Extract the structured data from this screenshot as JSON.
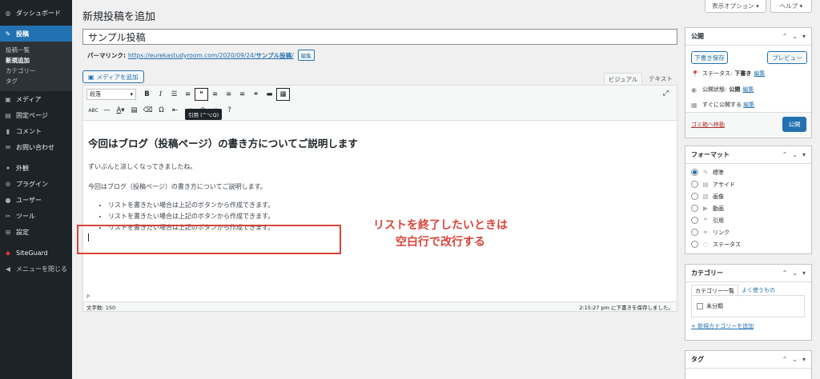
{
  "sidebar": {
    "items": [
      {
        "icon": "dashboard-icon",
        "glyph": "◍",
        "label": "ダッシュボード"
      },
      {
        "icon": "pin-icon",
        "glyph": "✎",
        "label": "投稿"
      },
      {
        "icon": "media-icon",
        "glyph": "▣",
        "label": "メディア"
      },
      {
        "icon": "page-icon",
        "glyph": "▤",
        "label": "固定ページ"
      },
      {
        "icon": "comment-icon",
        "glyph": "▮",
        "label": "コメント"
      },
      {
        "icon": "mail-icon",
        "glyph": "✉",
        "label": "お問い合わせ"
      },
      {
        "icon": "appearance-icon",
        "glyph": "✦",
        "label": "外観"
      },
      {
        "icon": "plugin-icon",
        "glyph": "⚙",
        "label": "プラグイン"
      },
      {
        "icon": "user-icon",
        "glyph": "●",
        "label": "ユーザー"
      },
      {
        "icon": "tool-icon",
        "glyph": "✂",
        "label": "ツール"
      },
      {
        "icon": "settings-icon",
        "glyph": "⊞",
        "label": "設定"
      },
      {
        "icon": "siteguard-icon",
        "glyph": "◆",
        "label": "SiteGuard"
      },
      {
        "icon": "collapse-icon",
        "glyph": "◀",
        "label": "メニューを閉じる"
      }
    ],
    "submenu": [
      "投稿一覧",
      "新規追加",
      "カテゴリー",
      "タグ"
    ]
  },
  "header": {
    "title": "新規投稿を追加",
    "screen_options": "表示オプション ▾",
    "help": "ヘルプ ▾"
  },
  "post": {
    "title": "サンプル投稿",
    "permalink_label": "パーマリンク:",
    "permalink_base": "https://eurekastudyroom.com/2020/09/24/",
    "permalink_slug": "サンプル投稿",
    "permalink_end": "/",
    "edit_label": "編集"
  },
  "editor": {
    "media_button": "メディアを追加",
    "tab_visual": "ビジュアル",
    "tab_text": "テキスト",
    "format_select": "段落",
    "tooltip": "引用 (^⌥Q)",
    "heading": "今回はブログ（投稿ページ）の書き方についてご説明します",
    "para1": "ずいぶんと涼しくなってきましたね。",
    "para2": "今回はブログ（投稿ページ）の書き方についてご説明します。",
    "list": [
      "リストを書きたい場合は上記のボタンから作成できます。",
      "リストを書きたい場合は上記のボタンから作成できます。",
      "リストを書きたい場合は上記のボタンから作成できます。"
    ],
    "path": "P",
    "word_count": "文字数: 150",
    "saved_status": "2:15:27 pm に下書きを保存しました。"
  },
  "annotation": {
    "line1": "リストを終了したいときは",
    "line2": "空白行で改行する",
    "color": "#d9453a"
  },
  "publish": {
    "title": "公開",
    "save_draft": "下書き保存",
    "preview": "プレビュー",
    "status_label": "ステータス:",
    "status_value": "下書き",
    "visibility_label": "公開状態:",
    "visibility_value": "公開",
    "schedule_label": "すぐに公開する",
    "edit": "編集",
    "trash": "ゴミ箱へ移動",
    "publish_button": "公開"
  },
  "format": {
    "title": "フォーマット",
    "options": [
      {
        "label": "標準",
        "icon": "pin-icon",
        "glyph": "✎",
        "selected": true
      },
      {
        "label": "アサイド",
        "icon": "aside-icon",
        "glyph": "▤",
        "selected": false
      },
      {
        "label": "画像",
        "icon": "image-icon",
        "glyph": "▨",
        "selected": false
      },
      {
        "label": "動画",
        "icon": "video-icon",
        "glyph": "▶",
        "selected": false
      },
      {
        "label": "引用",
        "icon": "quote-icon",
        "glyph": "❝",
        "selected": false
      },
      {
        "label": "リンク",
        "icon": "link-icon",
        "glyph": "⚭",
        "selected": false
      },
      {
        "label": "ステータス",
        "icon": "status-icon",
        "glyph": "◌",
        "selected": false
      }
    ]
  },
  "category": {
    "title": "カテゴリー",
    "tab_all": "カテゴリー一覧",
    "tab_popular": "よく使うもの",
    "item": "未分類",
    "add": "+ 新規カテゴリーを追加"
  },
  "tags": {
    "title": "タグ"
  },
  "colors": {
    "accent": "#2271b1",
    "sidebar_bg": "#1d2327",
    "trash": "#b32d2e"
  }
}
